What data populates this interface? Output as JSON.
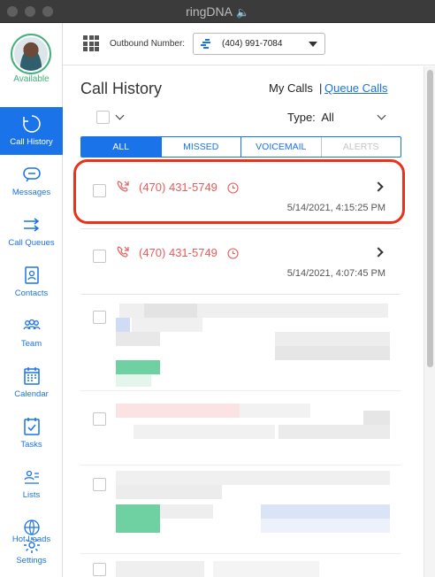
{
  "window": {
    "title": "ringDNA",
    "title_icon": "speaker-icon"
  },
  "user": {
    "status": "Available",
    "status_color": "#41b07a"
  },
  "nav": {
    "items": [
      {
        "label": "Call History",
        "icon": "call-history-icon",
        "active": true
      },
      {
        "label": "Messages",
        "icon": "messages-icon"
      },
      {
        "label": "Call Queues",
        "icon": "call-queues-icon"
      },
      {
        "label": "Contacts",
        "icon": "contacts-icon"
      },
      {
        "label": "Team",
        "icon": "team-icon"
      },
      {
        "label": "Calendar",
        "icon": "calendar-icon"
      },
      {
        "label": "Tasks",
        "icon": "tasks-icon"
      },
      {
        "label": "Lists",
        "icon": "lists-icon"
      },
      {
        "label": "Hot Leads",
        "icon": "hot-leads-icon"
      },
      {
        "label": "Settings",
        "icon": "settings-icon"
      }
    ]
  },
  "topbar": {
    "outbound_label": "Outbound Number:",
    "outbound_number": "(404) 991-7084"
  },
  "call_history": {
    "title": "Call History",
    "my_calls": "My Calls",
    "separator": "|",
    "queue_calls": "Queue Calls",
    "type_label": "Type:",
    "type_value": "All",
    "tabs": [
      {
        "label": "ALL",
        "active": true
      },
      {
        "label": "MISSED"
      },
      {
        "label": "VOICEMAIL"
      },
      {
        "label": "ALERTS",
        "disabled": true
      }
    ],
    "calls": [
      {
        "number": "(470) 431-5749",
        "time": "5/14/2021, 4:15:25 PM"
      },
      {
        "number": "(470) 431-5749",
        "time": "5/14/2021, 4:07:45 PM"
      }
    ]
  },
  "colors": {
    "accent": "#1a73e8",
    "missed": "#e95b5b",
    "highlight": "#e8321b"
  }
}
